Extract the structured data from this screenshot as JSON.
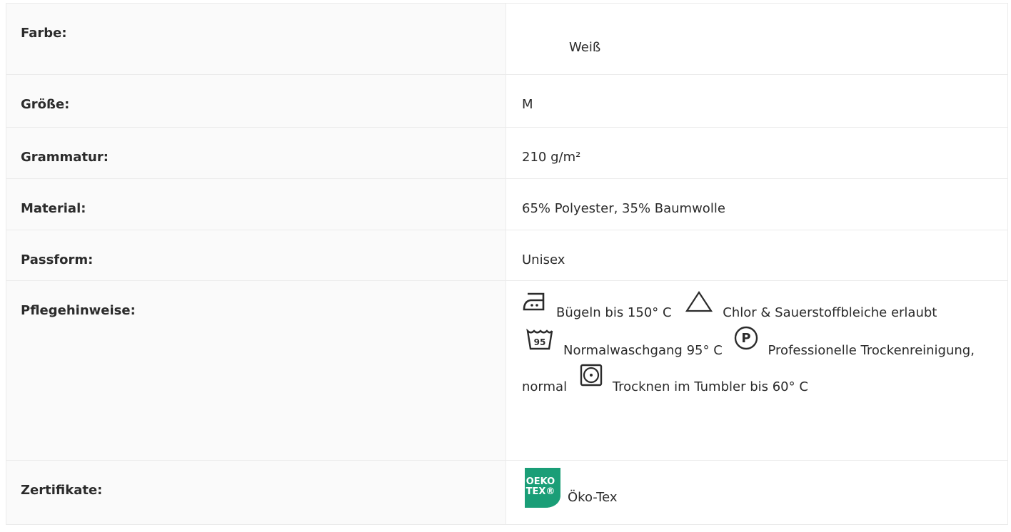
{
  "rows": {
    "farbe": {
      "label": "Farbe:",
      "value": "Weiß"
    },
    "size": {
      "label": "Größe:",
      "value": "M"
    },
    "gram": {
      "label": "Grammatur:",
      "value": "210 g/m²"
    },
    "material": {
      "label": "Material:",
      "value": "65% Polyester, 35% Baumwolle"
    },
    "fit": {
      "label": "Passform:",
      "value": "Unisex"
    },
    "care": {
      "label": "Pflegehinweise:",
      "items": [
        {
          "icon": "iron-icon",
          "text": "Bügeln bis 150° C"
        },
        {
          "icon": "bleach-triangle-icon",
          "text": "Chlor & Sauerstoffbleiche erlaubt"
        },
        {
          "icon": "wash-95-icon",
          "icon_text": "95",
          "text": "Normalwaschgang 95° C"
        },
        {
          "icon": "professional-clean-p-icon",
          "icon_text": "P",
          "text": "Professionelle Trockenreinigung, normal"
        },
        {
          "icon": "tumble-dry-icon",
          "text": "Trocknen im Tumbler bis 60° C"
        }
      ]
    },
    "cert": {
      "label": "Zertifikate:",
      "badge_text_line1": "OEKO",
      "badge_text_line2": "TEX®",
      "badge_color": "#1a9e77",
      "value": "Öko-Tex"
    }
  }
}
